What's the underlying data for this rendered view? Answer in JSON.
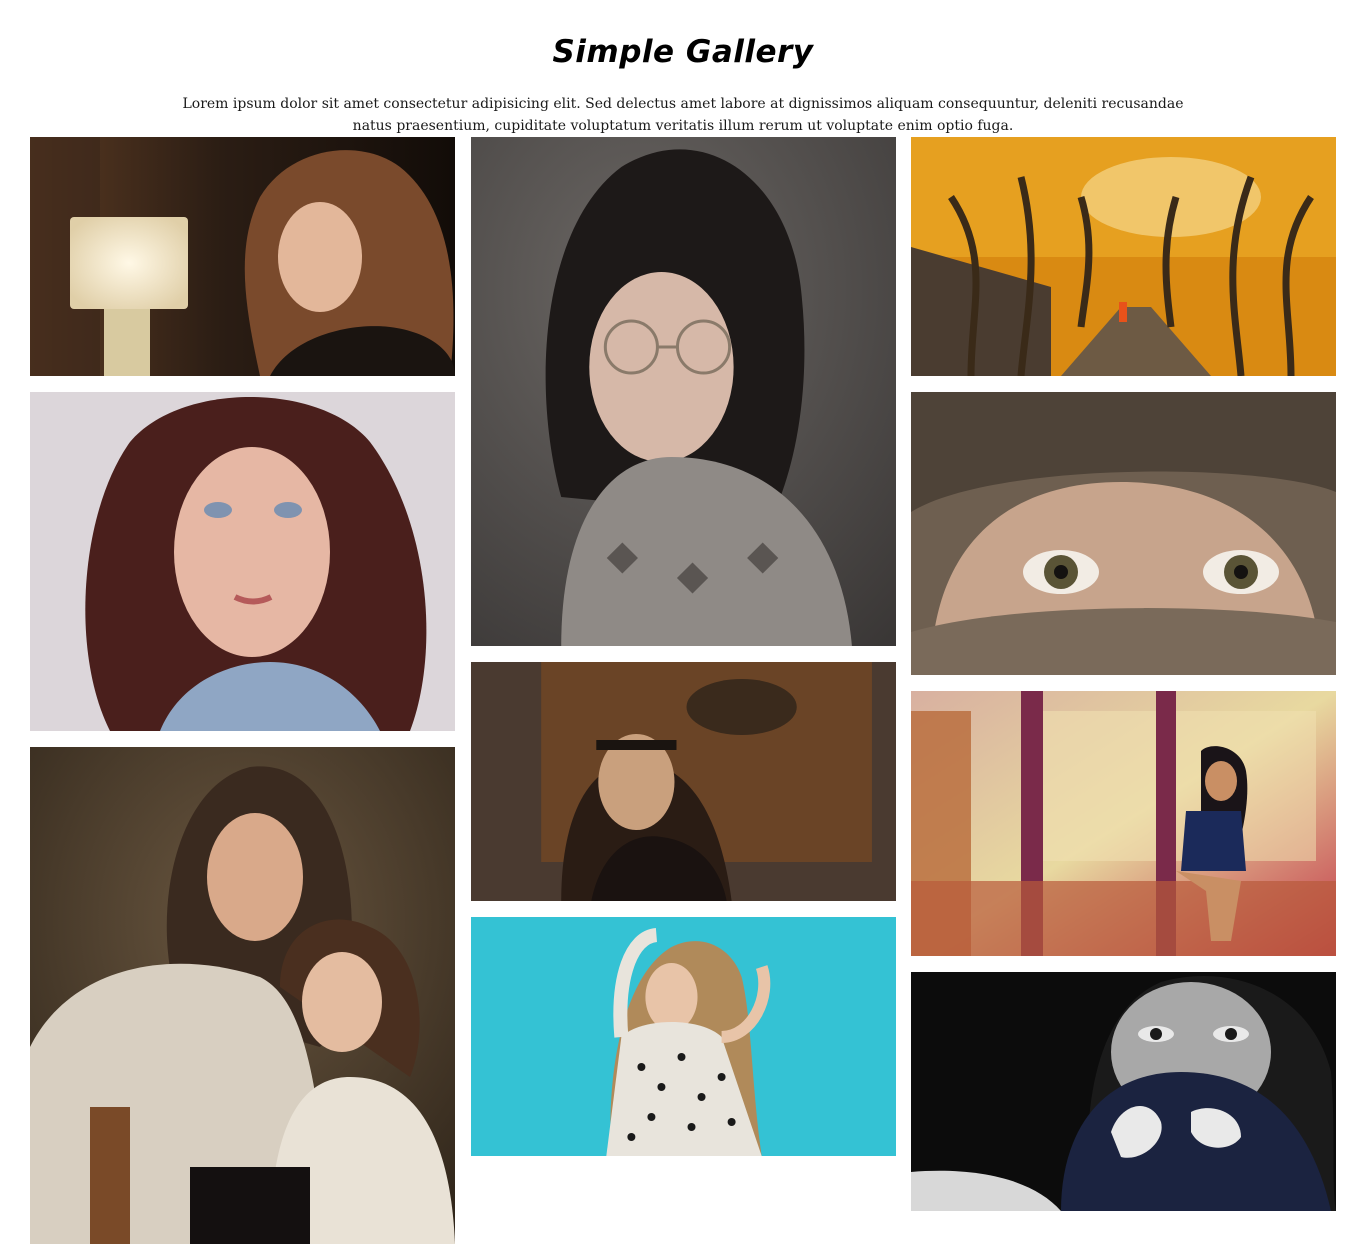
{
  "header": {
    "title": "Simple Gallery",
    "description": "Lorem ipsum dolor sit amet consectetur adipisicing elit. Sed delectus amet labore at dignissimos aliquam consequuntur, deleniti recusandae natus praesentium, cupiditate voluptatum veritatis illum rerum ut voluptate enim optio fuga."
  },
  "gallery": {
    "columns": [
      [
        {
          "name": "photo-woman-lamp",
          "colors": [
            "#2b1d14",
            "#7a4a2c",
            "#e9e1cf",
            "#1a1410"
          ]
        },
        {
          "name": "photo-woman-denim",
          "colors": [
            "#d9d4d8",
            "#4a1f1c",
            "#e6b7a4",
            "#8fa6c4"
          ]
        },
        {
          "name": "photo-mother-child",
          "colors": [
            "#4c3e2e",
            "#3a2a1f",
            "#d8cfc1",
            "#1b1512"
          ]
        }
      ],
      [
        {
          "name": "photo-woman-glasses",
          "colors": [
            "#4e4b4a",
            "#1d1918",
            "#d6b8a8",
            "#8f8a86"
          ]
        },
        {
          "name": "photo-woman-table",
          "colors": [
            "#5a3a22",
            "#2a1c14",
            "#c9a07d",
            "#7a5a3c"
          ]
        },
        {
          "name": "photo-woman-turquoise",
          "colors": [
            "#34c2d4",
            "#1a1a1a",
            "#e8e4dc",
            "#c98f64"
          ]
        }
      ],
      [
        {
          "name": "photo-autumn-trees",
          "colors": [
            "#d98a12",
            "#3a2a18",
            "#f2c14a",
            "#6d5a44"
          ]
        },
        {
          "name": "photo-eyes-hood",
          "colors": [
            "#6e5f50",
            "#3d342c",
            "#b39b86",
            "#2a2420"
          ]
        },
        {
          "name": "photo-woman-tram",
          "colors": [
            "#b86a3a",
            "#3a1f4a",
            "#e8d9a0",
            "#c2384a"
          ]
        },
        {
          "name": "photo-woman-scarf-bw",
          "colors": [
            "#0c0c0c",
            "#e9e9e9",
            "#1b2340",
            "#6a6a6a"
          ]
        }
      ]
    ]
  }
}
